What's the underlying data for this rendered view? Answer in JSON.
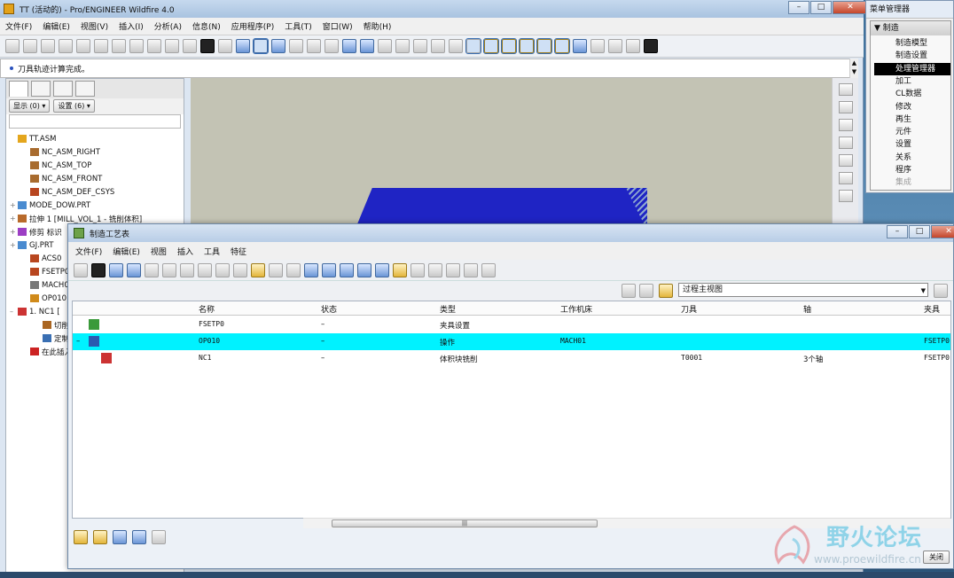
{
  "main_window": {
    "title": "TT (活动的) - Pro/ENGINEER Wildfire 4.0",
    "buttons": [
      "–",
      "□",
      "✕"
    ],
    "menu": [
      "文件(F)",
      "编辑(E)",
      "视图(V)",
      "插入(I)",
      "分析(A)",
      "信息(N)",
      "应用程序(P)",
      "工具(T)",
      "窗口(W)",
      "帮助(H)"
    ],
    "message": "刀具轨迹计算完成。"
  },
  "left_panel": {
    "show_label": "显示",
    "show_count": "(0)",
    "settings_label": "设置",
    "settings_count": "(6)",
    "tree": [
      {
        "label": "TT.ASM",
        "indent": 0,
        "expander": ""
      },
      {
        "label": "NC_ASM_RIGHT",
        "indent": 1,
        "expander": ""
      },
      {
        "label": "NC_ASM_TOP",
        "indent": 1,
        "expander": ""
      },
      {
        "label": "NC_ASM_FRONT",
        "indent": 1,
        "expander": ""
      },
      {
        "label": "NC_ASM_DEF_CSYS",
        "indent": 1,
        "expander": ""
      },
      {
        "label": "MODE_DOW.PRT",
        "indent": 0,
        "expander": "+"
      },
      {
        "label": "拉伸 1 [MILL_VOL_1 - 铣削体积]",
        "indent": 0,
        "expander": "+"
      },
      {
        "label": "修剪 标识",
        "indent": 0,
        "expander": "+"
      },
      {
        "label": "GJ.PRT",
        "indent": 0,
        "expander": "+"
      },
      {
        "label": "ACS0",
        "indent": 1,
        "expander": ""
      },
      {
        "label": "FSETP0",
        "indent": 1,
        "expander": ""
      },
      {
        "label": "MACH0",
        "indent": 1,
        "expander": ""
      },
      {
        "label": "OP010 [",
        "indent": 1,
        "expander": ""
      },
      {
        "label": "1. NC1 [",
        "indent": 0,
        "expander": "–"
      },
      {
        "label": "切削",
        "indent": 2,
        "expander": ""
      },
      {
        "label": "定制",
        "indent": 2,
        "expander": ""
      },
      {
        "label": "在此插入",
        "indent": 1,
        "expander": ""
      }
    ]
  },
  "menu_manager": {
    "title": "菜单管理器",
    "header": "制造",
    "items": [
      {
        "label": "制造模型",
        "state": "normal"
      },
      {
        "label": "制造设置",
        "state": "normal"
      },
      {
        "label": "处理管理器",
        "state": "selected"
      },
      {
        "label": "加工",
        "state": "normal"
      },
      {
        "label": "CL数据",
        "state": "normal"
      },
      {
        "label": "修改",
        "state": "normal"
      },
      {
        "label": "再生",
        "state": "normal"
      },
      {
        "label": "元件",
        "state": "normal"
      },
      {
        "label": "设置",
        "state": "normal"
      },
      {
        "label": "关系",
        "state": "normal"
      },
      {
        "label": "程序",
        "state": "normal"
      },
      {
        "label": "集成",
        "state": "disabled"
      }
    ]
  },
  "process_dialog": {
    "title": "制造工艺表",
    "buttons": [
      "–",
      "□",
      "✕"
    ],
    "menu": [
      "文件(F)",
      "编辑(E)",
      "视图",
      "插入",
      "工具",
      "特征"
    ],
    "view_select": "过程主视图",
    "columns": [
      "名称",
      "状态",
      "类型",
      "工作机床",
      "刀具",
      "轴",
      "夹具"
    ],
    "rows": [
      {
        "name": "FSETP0",
        "status": "–",
        "type": "夹具设置",
        "machine": "",
        "tool": "",
        "axis": "",
        "fixture": "",
        "selected": false,
        "expander": ""
      },
      {
        "name": "OP010",
        "status": "–",
        "type": "操作",
        "machine": "MACH01",
        "tool": "",
        "axis": "",
        "fixture": "FSETP0",
        "selected": true,
        "expander": "–"
      },
      {
        "name": "NC1",
        "status": "–",
        "type": "体积块铣削",
        "machine": "",
        "tool": "T0001",
        "axis": "3个轴",
        "fixture": "FSETP0",
        "selected": false,
        "expander": ""
      }
    ],
    "close_label": "关闭"
  },
  "watermark": {
    "text": "野火论坛",
    "url": "www.proewildfire.cn"
  },
  "colors": {
    "selection_row": "#00f2ff",
    "part_blue": "#1f24c4",
    "menu_selected": "#000000"
  }
}
